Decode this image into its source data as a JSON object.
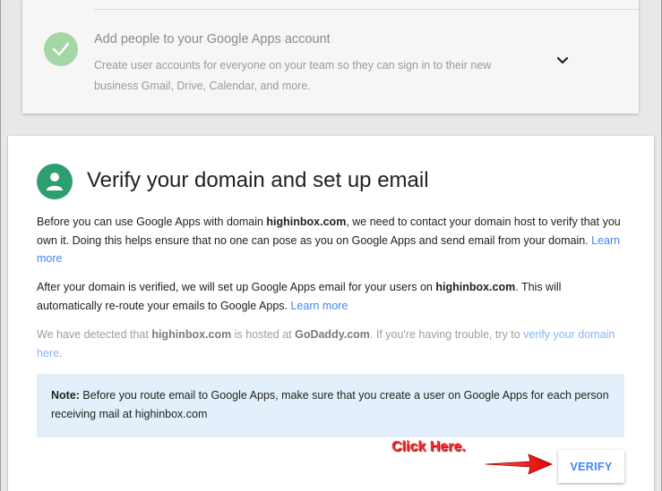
{
  "completed_step": {
    "title": "Add people to your Google Apps account",
    "description": "Create user accounts for everyone on your team so they can sign in to their new business Gmail, Drive, Calendar, and more.",
    "icons": {
      "status": "check-icon",
      "expand": "chevron-down-icon"
    }
  },
  "active_step": {
    "title": "Verify your domain and set up email",
    "icon": "person-icon",
    "para1": {
      "t1": "Before you can use Google Apps with domain ",
      "domain": "highinbox.com",
      "t2": ", we need to contact your domain host to verify that you own it. Doing this helps ensure that no one can pose as you on Google Apps and send email from your domain. ",
      "link": "Learn more"
    },
    "para2": {
      "t1": "After your domain is verified, we will set up Google Apps email for your users on ",
      "domain": "highinbox.com",
      "t2": ". This will automatically re-route your emails to Google Apps. ",
      "link": "Learn more"
    },
    "para3": {
      "t1": "We have detected that ",
      "domain": "highinbox.com",
      "t2": " is hosted at ",
      "host": "GoDaddy.com",
      "t3": ". If you're having trouble, try to ",
      "link": "verify your domain here",
      "t4": "."
    },
    "note": {
      "label": "Note:",
      "text": " Before you route email to Google Apps, make sure that you create a user on Google Apps for each person receiving mail at highinbox.com"
    },
    "verify_label": "VERIFY"
  },
  "annotation": {
    "text": "Click Here.",
    "color": "#ff2a2a"
  },
  "colors": {
    "accent": "#4285f4",
    "person_icon_bg": "#2e9e6f",
    "check_bg": "#a5d6a7",
    "note_bg": "#e3f0fb"
  }
}
